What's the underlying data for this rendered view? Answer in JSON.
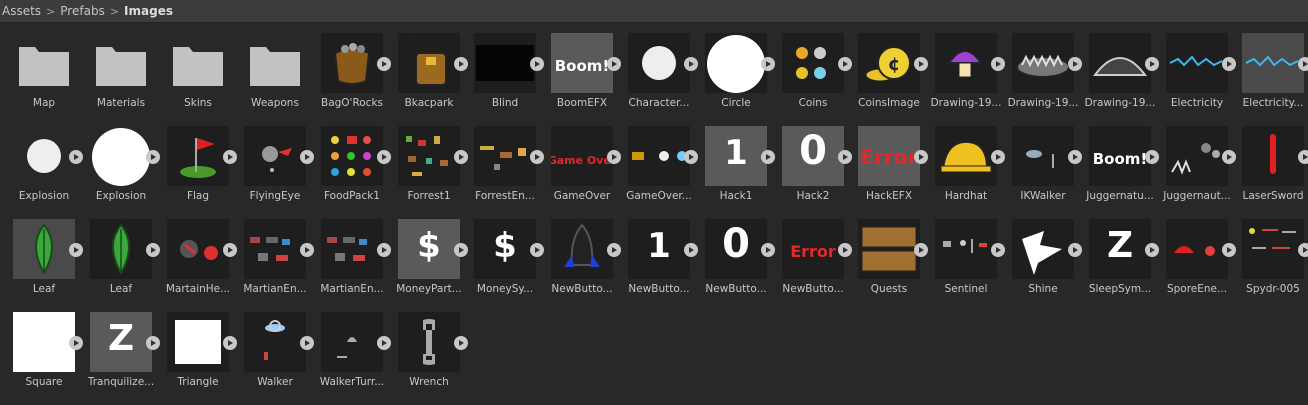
{
  "breadcrumb": [
    "Assets",
    "Prefabs",
    "Images"
  ],
  "items": [
    {
      "label": "Map",
      "icon": "folder-icon",
      "kind": "folder"
    },
    {
      "label": "Materials",
      "icon": "folder-icon",
      "kind": "folder"
    },
    {
      "label": "Skins",
      "icon": "folder-icon",
      "kind": "folder"
    },
    {
      "label": "Weapons",
      "icon": "folder-icon",
      "kind": "folder"
    },
    {
      "label": "BagO'Rocks",
      "icon": "bag-of-rocks-icon",
      "kind": "sprite"
    },
    {
      "label": "Bkacpark",
      "icon": "backpack-icon",
      "kind": "sprite"
    },
    {
      "label": "Blind",
      "icon": "black-rectangle-icon",
      "kind": "sprite"
    },
    {
      "label": "BoomEFX",
      "icon": "boom-text-icon",
      "kind": "sprite"
    },
    {
      "label": "Character...",
      "icon": "circle-icon",
      "kind": "sprite"
    },
    {
      "label": "Circle",
      "icon": "circle-icon",
      "kind": "sprite"
    },
    {
      "label": "Coins",
      "icon": "coins-icon",
      "kind": "sprite"
    },
    {
      "label": "CoinsImage",
      "icon": "coin-stack-icon",
      "kind": "sprite"
    },
    {
      "label": "Drawing-19...",
      "icon": "mushroom-icon",
      "kind": "sprite"
    },
    {
      "label": "Drawing-19...",
      "icon": "bear-trap-icon",
      "kind": "sprite"
    },
    {
      "label": "Drawing-19...",
      "icon": "bear-trap-outline-icon",
      "kind": "sprite"
    },
    {
      "label": "Electricity",
      "icon": "electricity-icon",
      "kind": "sprite"
    },
    {
      "label": "Electricity...",
      "icon": "electricity-icon",
      "kind": "sprite"
    },
    {
      "label": "Explosion",
      "icon": "circle-icon",
      "kind": "sprite"
    },
    {
      "label": "Explosion",
      "icon": "circle-icon",
      "kind": "sprite"
    },
    {
      "label": "Flag",
      "icon": "flag-icon",
      "kind": "sprite"
    },
    {
      "label": "FlyingEye",
      "icon": "flying-eye-icon",
      "kind": "sprite"
    },
    {
      "label": "FoodPack1",
      "icon": "food-pack-icon",
      "kind": "sprite"
    },
    {
      "label": "Forrest1",
      "icon": "forest-sprites-icon",
      "kind": "sprite"
    },
    {
      "label": "ForrestEn...",
      "icon": "forest-enemy-icon",
      "kind": "sprite"
    },
    {
      "label": "GameOver",
      "icon": "game-over-text-icon",
      "kind": "sprite"
    },
    {
      "label": "GameOver...",
      "icon": "game-over-sprites-icon",
      "kind": "sprite"
    },
    {
      "label": "Hack1",
      "icon": "digit-one-icon",
      "kind": "sprite"
    },
    {
      "label": "Hack2",
      "icon": "digit-zero-icon",
      "kind": "sprite"
    },
    {
      "label": "HackEFX",
      "icon": "error-text-icon",
      "kind": "sprite"
    },
    {
      "label": "Hardhat",
      "icon": "hardhat-icon",
      "kind": "sprite"
    },
    {
      "label": "IKWalker",
      "icon": "ik-walker-icon",
      "kind": "sprite"
    },
    {
      "label": "Juggernatu...",
      "icon": "boom-text-icon",
      "kind": "sprite"
    },
    {
      "label": "Juggernaut...",
      "icon": "juggernaut-icon",
      "kind": "sprite"
    },
    {
      "label": "LaserSword",
      "icon": "laser-sword-icon",
      "kind": "sprite"
    },
    {
      "label": "Leaf",
      "icon": "leaf-icon",
      "kind": "sprite"
    },
    {
      "label": "Leaf",
      "icon": "leaf-icon",
      "kind": "sprite"
    },
    {
      "label": "MartainHe...",
      "icon": "martian-head-icon",
      "kind": "sprite"
    },
    {
      "label": "MartianEn...",
      "icon": "martian-enemy-icon",
      "kind": "sprite"
    },
    {
      "label": "MartianEn...",
      "icon": "martian-enemy-icon",
      "kind": "sprite"
    },
    {
      "label": "MoneyPart...",
      "icon": "dollar-icon",
      "kind": "sprite"
    },
    {
      "label": "MoneySy...",
      "icon": "dollar-icon",
      "kind": "sprite"
    },
    {
      "label": "NewButto...",
      "icon": "rocket-icon",
      "kind": "sprite"
    },
    {
      "label": "NewButto...",
      "icon": "digit-one-icon",
      "kind": "sprite"
    },
    {
      "label": "NewButto...",
      "icon": "digit-zero-icon",
      "kind": "sprite"
    },
    {
      "label": "NewButto...",
      "icon": "error-text-icon",
      "kind": "sprite"
    },
    {
      "label": "Quests",
      "icon": "quests-icon",
      "kind": "sprite"
    },
    {
      "label": "Sentinel",
      "icon": "sentinel-icon",
      "kind": "sprite"
    },
    {
      "label": "Shine",
      "icon": "shine-icon",
      "kind": "sprite"
    },
    {
      "label": "SleepSym...",
      "icon": "sleep-z-icon",
      "kind": "sprite"
    },
    {
      "label": "SporeEne...",
      "icon": "spore-enemy-icon",
      "kind": "sprite"
    },
    {
      "label": "Spydr-005",
      "icon": "spider-icon",
      "kind": "sprite"
    },
    {
      "label": "Square",
      "icon": "square-icon",
      "kind": "sprite"
    },
    {
      "label": "Tranquilize...",
      "icon": "sleep-z-icon",
      "kind": "sprite"
    },
    {
      "label": "Triangle",
      "icon": "square-icon",
      "kind": "sprite"
    },
    {
      "label": "Walker",
      "icon": "walker-icon",
      "kind": "sprite"
    },
    {
      "label": "WalkerTurr...",
      "icon": "walker-turret-icon",
      "kind": "sprite"
    },
    {
      "label": "Wrench",
      "icon": "wrench-icon",
      "kind": "sprite"
    }
  ],
  "thumb_text": {
    "boom": "Boom!",
    "game_over": "Game Over",
    "error": "Error",
    "one": "1",
    "zero": "0",
    "dollar": "$",
    "z": "Z"
  },
  "colors": {
    "background": "#282828",
    "breadcrumb_bar": "#3c3c3c",
    "folder": "#c2c2c2",
    "error_red": "#e0282d",
    "electric_blue": "#3ab8f0"
  }
}
